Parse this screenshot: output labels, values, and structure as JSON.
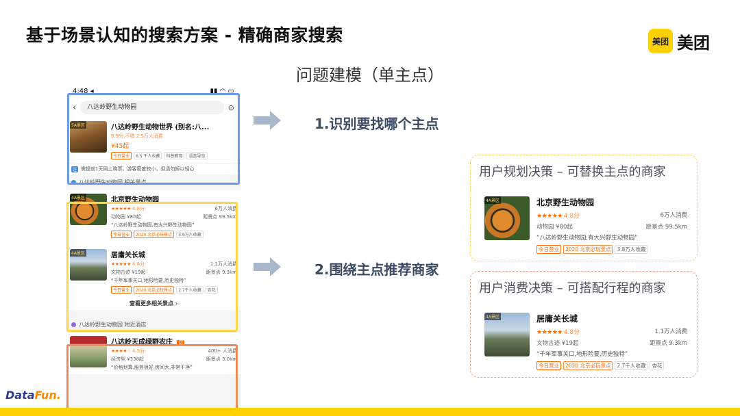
{
  "header": {
    "title": "基于场景认知的搜索方案 - 精确商家搜索",
    "subtitle": "问题建模（单主点）",
    "logo_badge": "美团",
    "logo_word": "美团"
  },
  "phone": {
    "status_time": "4:48 ◂",
    "status_right": "▮▮ ◠ ▭",
    "search_query": "八达岭野生动物园",
    "main_result": {
      "tag": "5A景区",
      "name": "八达岭野生动物世界 (别名:八...",
      "rating_line": "3.9分,不错  2.5万人消费",
      "price": "¥45起",
      "chips": [
        "今日营业",
        "6.5 千人收藏",
        "科普教育",
        "语音导览"
      ]
    },
    "notice_badge": "注",
    "notice_text": "需提前1天网上购票。游客密度较小，但请勿掉以轻心",
    "related_header": "八达岭野生动物园 相关景点",
    "related": [
      {
        "tag": "4A景区",
        "name": "北京野生动物园",
        "stars": "★★★★★",
        "score": "4.8分",
        "consume": "6万人消费",
        "category": "动物园 ¥80起",
        "distance": "距景点 99.5km",
        "quote": "“八达岭野生动物园,有大兴野生动物园”",
        "chips": [
          "今日营业",
          "2020 北京必玩景点",
          "3.8万人收藏"
        ]
      },
      {
        "tag": "4A景区",
        "name": "居庸关长城",
        "stars": "★★★★★",
        "score": "4.8分",
        "consume": "1.1万人消费",
        "category": "文物古迹 ¥19起",
        "distance": "距景点 9.3km",
        "quote": "“千年军事关口,地形险要,历史独特”",
        "chips": [
          "今日营业",
          "2020 北京必玩景点",
          "2.7千人收藏",
          "杏花"
        ]
      }
    ],
    "more_label": "查看更多相关景点  ›",
    "hotel_header": "八达岭野生动物园 附近酒店",
    "hotel": {
      "name": "八达岭天成绿野农庄",
      "badge": "订",
      "stars": "★★★★☆",
      "score": "4.5分",
      "consume": "400+ 人消费",
      "category": "经济型 ¥338起",
      "distance": "距景点 3.0km",
      "quote": "“价格划算,服务很好,房间大,非常干净”"
    }
  },
  "steps": {
    "step1": "1.识别要找哪个主点",
    "step2": "2.围绕主点推荐商家"
  },
  "panels": [
    {
      "title": "用户规划决策 – 可替换主点的商家",
      "tag": "4A景区",
      "name": "北京野生动物园",
      "stars": "★★★★★",
      "score": "4.8分",
      "consume": "6万人消费",
      "category": "动物园 ¥80起",
      "distance": "距景点 99.5km",
      "quote": "“八达岭野生动物园,有大兴野生动物园”",
      "chips": [
        "今日营业",
        "2020 北京必玩景点",
        "3.8万人收藏"
      ]
    },
    {
      "title": "用户消费决策 – 可搭配行程的商家",
      "tag": "4A景区",
      "name": "居庸关长城",
      "stars": "★★★★★",
      "score": "4.8分",
      "consume": "1.1万人消费",
      "category": "文物古迹 ¥19起",
      "distance": "距景点 9.3km",
      "quote": "“千年军事关口,地形险要,历史独特”",
      "chips": [
        "今日营业",
        "2020 北京必玩景点",
        "2.7千人收藏",
        "杏花"
      ]
    }
  ],
  "footer": {
    "brand_main": "Data",
    "brand_accent": "Fun."
  },
  "colors": {
    "meituan_yellow": "#ffd100",
    "accent_orange": "#ff6a00",
    "box_blue": "#6b9be6",
    "box_yellow": "#ffd54a",
    "box_red": "#f08a5d"
  }
}
